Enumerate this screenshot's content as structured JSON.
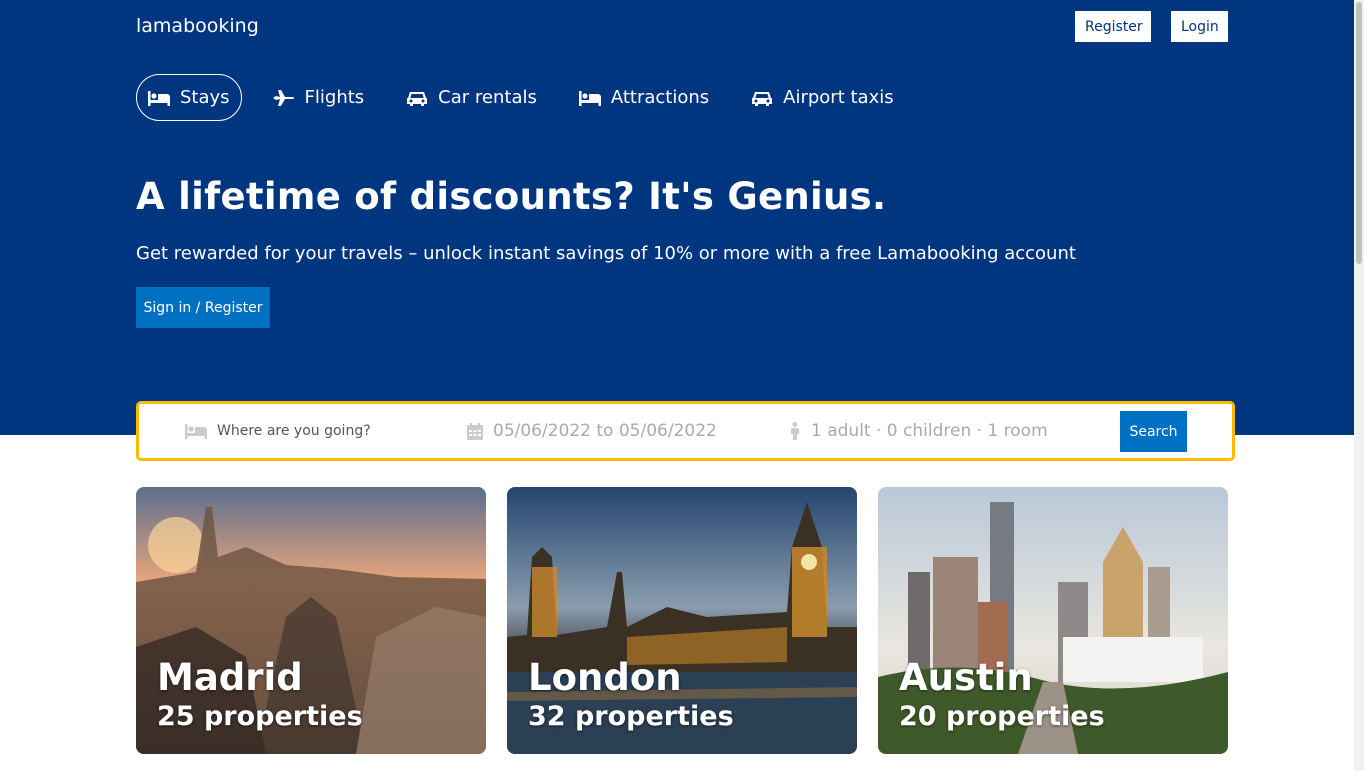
{
  "brand": {
    "logo": "lamabooking"
  },
  "header": {
    "register_label": "Register",
    "login_label": "Login"
  },
  "nav_tabs": [
    {
      "label": "Stays",
      "icon": "bed-icon",
      "active": true
    },
    {
      "label": "Flights",
      "icon": "plane-icon",
      "active": false
    },
    {
      "label": "Car rentals",
      "icon": "car-icon",
      "active": false
    },
    {
      "label": "Attractions",
      "icon": "bed-icon",
      "active": false
    },
    {
      "label": "Airport taxis",
      "icon": "taxi-icon",
      "active": false
    }
  ],
  "hero": {
    "title": "A lifetime of discounts? It's Genius.",
    "description": "Get rewarded for your travels – unlock instant savings of 10% or more with a free Lamabooking account",
    "signin_label": "Sign in / Register"
  },
  "search": {
    "destination_placeholder": "Where are you going?",
    "date_range": "05/06/2022 to 05/06/2022",
    "options": "1 adult · 0 children · 1 room",
    "button_label": "Search"
  },
  "featured": [
    {
      "city": "Madrid",
      "count": "25 properties"
    },
    {
      "city": "London",
      "count": "32 properties"
    },
    {
      "city": "Austin",
      "count": "20 properties"
    }
  ],
  "colors": {
    "header_bg": "#003580",
    "button_blue": "#0071c2",
    "search_border": "#febb02"
  }
}
